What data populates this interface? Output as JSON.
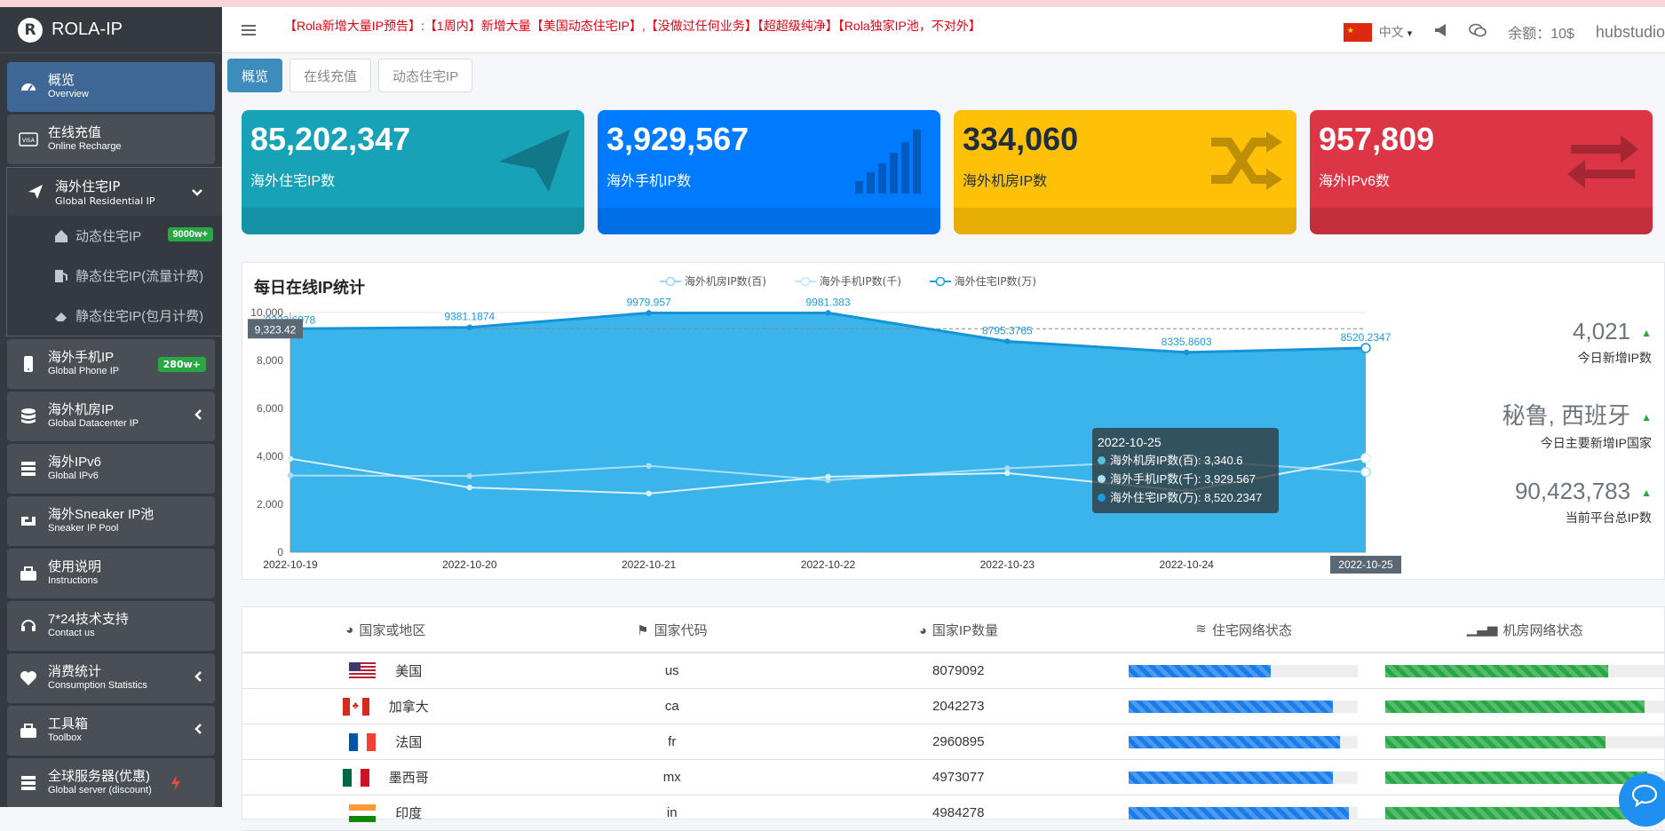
{
  "brand": {
    "logo": "R",
    "name": "ROLA-IP"
  },
  "sidebar": {
    "items": [
      {
        "name": "概览",
        "sub": "Overview",
        "icon": "dashboard-icon"
      },
      {
        "name": "在线充值",
        "sub": "Online Recharge",
        "icon": "visa-card-icon"
      },
      {
        "name": "海外住宅IP",
        "sub": "Global Residential IP",
        "icon": "paper-plane-icon"
      },
      {
        "name": "海外手机IP",
        "sub": "Global Phone IP",
        "icon": "mobile-icon",
        "badge": "280w+"
      },
      {
        "name": "海外机房IP",
        "sub": "Global Datacenter IP",
        "icon": "database-icon"
      },
      {
        "name": "海外IPv6",
        "sub": "Global IPv6",
        "icon": "server-icon"
      },
      {
        "name": "海外Sneaker IP池",
        "sub": "Sneaker IP Pool",
        "icon": "sneaker-icon"
      },
      {
        "name": "使用说明",
        "sub": "Instructions",
        "icon": "toolbox-icon"
      },
      {
        "name": "7*24技术支持",
        "sub": "Contact us",
        "icon": "headset-icon"
      },
      {
        "name": "消费统计",
        "sub": "Consumption Statistics",
        "icon": "heartbeat-icon"
      },
      {
        "name": "工具箱",
        "sub": "Toolbox",
        "icon": "toolbox-icon"
      },
      {
        "name": "全球服务器(优惠)",
        "sub": "Global server (discount)",
        "icon": "server-icon"
      }
    ],
    "submenu": [
      {
        "label": "动态住宅IP",
        "badge": "9000w+"
      },
      {
        "label": "静态住宅IP(流量计费)"
      },
      {
        "label": "静态住宅IP(包月计费)"
      }
    ]
  },
  "topbar": {
    "notice": "【Rola新增大量IP预告】:【1周内】新增大量【美国动态住宅IP】,【没做过任何业务】【超超级纯净】【Rola独家IP池，不对外】",
    "lang": "中文",
    "balance": "余额：10$",
    "user": "hubstudio"
  },
  "tabs": [
    "概览",
    "在线充值",
    "动态住宅IP"
  ],
  "cards": [
    {
      "value": "85,202,347",
      "label": "海外住宅IP数",
      "color": "#17a2b8",
      "icon": "paper-plane-icon"
    },
    {
      "value": "3,929,567",
      "label": "海外手机IP数",
      "color": "#007bff",
      "icon": "signal-icon"
    },
    {
      "value": "334,060",
      "label": "海外机房IP数",
      "color": "#ffc107",
      "icon": "shuffle-icon"
    },
    {
      "value": "957,809",
      "label": "海外IPv6数",
      "color": "#dc3545",
      "icon": "exchange-icon"
    }
  ],
  "chart_title": "每日在线IP统计",
  "chart_data": {
    "type": "area",
    "categories": [
      "2022-10-19",
      "2022-10-20",
      "2022-10-21",
      "2022-10-22",
      "2022-10-23",
      "2022-10-24",
      "2022-10-25"
    ],
    "ylim": [
      0,
      10000
    ],
    "yticks": [
      "0",
      "2,000",
      "4,000",
      "6,000",
      "8,000",
      "10,000"
    ],
    "series": [
      {
        "name": "海外机房IP数(百)",
        "values": [
          3200,
          3180,
          3600,
          3000,
          3500,
          3850,
          3340.6
        ],
        "color": "#a8e0f5"
      },
      {
        "name": "海外手机IP数(千)",
        "values": [
          3900,
          2700,
          2450,
          3150,
          3300,
          2550,
          3929.567
        ],
        "color": "#cfeefb"
      },
      {
        "name": "海外住宅IP数(万)",
        "values": [
          9323.42,
          9381.1874,
          9979.957,
          9981.383,
          8795.3765,
          8335.8603,
          8520.2347
        ],
        "color": "#1aa1e5"
      }
    ],
    "point_labels": [
      "9323.6078",
      "9381.1874",
      "9979.957",
      "9981.383",
      "8795.3765",
      "8335.8603",
      "8520.2347"
    ],
    "marker_label": "9,323.42",
    "highlight_x": "2022-10-25"
  },
  "tooltip": {
    "date": "2022-10-25",
    "rows": [
      {
        "text": "海外机房IP数(百): 3,340.6",
        "color": "#5bc0de"
      },
      {
        "text": "海外手机IP数(千): 3,929.567",
        "color": "#aee0f3"
      },
      {
        "text": "海外住宅IP数(万): 8,520.2347",
        "color": "#1a9ce0"
      }
    ]
  },
  "stats": [
    {
      "value": "4,021",
      "label": "今日新增IP数"
    },
    {
      "value": "秘鲁, 西班牙",
      "label": "今日主要新增IP国家"
    },
    {
      "value": "90,423,783",
      "label": "当前平台总IP数"
    }
  ],
  "table": {
    "headers": [
      "国家或地区",
      "国家代码",
      "国家IP数量",
      "住宅网络状态",
      "机房网络状态"
    ],
    "rows": [
      {
        "country": "美国",
        "code": "us",
        "count": "8079092",
        "res": 0.62,
        "dc": 0.8
      },
      {
        "country": "加拿大",
        "code": "ca",
        "count": "2042273",
        "res": 0.89,
        "dc": 0.93
      },
      {
        "country": "法国",
        "code": "fr",
        "count": "2960895",
        "res": 0.92,
        "dc": 0.79
      },
      {
        "country": "墨西哥",
        "code": "mx",
        "count": "4973077",
        "res": 0.89,
        "dc": 0.94
      },
      {
        "country": "印度",
        "code": "in",
        "count": "4984278",
        "res": 0.96,
        "dc": 0.94
      }
    ]
  }
}
